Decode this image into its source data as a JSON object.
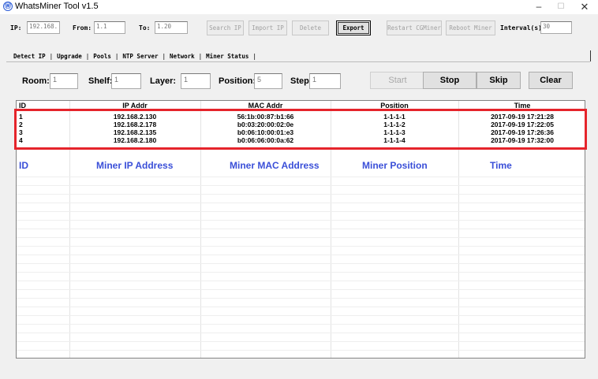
{
  "window": {
    "title": "WhatsMiner Tool v1.5",
    "app_icon": "Ⓦ",
    "minimize": "–",
    "maximize": "☐",
    "close": "✕"
  },
  "toolbar": {
    "ip_label": "IP:",
    "ip_value": "192.168.",
    "from_label": "From:",
    "from_value": "1.1",
    "to_label": "To:",
    "to_value": "1.20",
    "search_ip": "Search IP",
    "import_ip": "Import IP",
    "delete": "Delete",
    "export": "Export",
    "restart_cgminer": "Restart CGMiner",
    "reboot_miner": "Reboot Miner",
    "interval_label": "Interval(s)",
    "interval_value": "30"
  },
  "tabs": [
    "Detect IP",
    "Upgrade",
    "Pools",
    "NTP Server",
    "Network",
    "Miner Status"
  ],
  "detect": {
    "room_label": "Room:",
    "room_value": "1",
    "shelf_label": "Shelf:",
    "shelf_value": "1",
    "layer_label": "Layer:",
    "layer_value": "1",
    "position_label": "Position:",
    "position_value": "5",
    "step_label": "Step:",
    "step_value": "1",
    "start": "Start",
    "stop": "Stop",
    "skip": "Skip",
    "clear": "Clear"
  },
  "table": {
    "headers": [
      "ID",
      "IP Addr",
      "MAC Addr",
      "Position",
      "Time"
    ],
    "rows": [
      [
        "1",
        "192.168.2.130",
        "56:1b:00:87:b1:66",
        "1-1-1-1",
        "2017-09-19 17:21:28"
      ],
      [
        "2",
        "192.168.2.178",
        "b0:03:20:00:02:0e",
        "1-1-1-2",
        "2017-09-19 17:22:05"
      ],
      [
        "3",
        "192.168.2.135",
        "b0:06:10:00:01:e3",
        "1-1-1-3",
        "2017-09-19 17:26:36"
      ],
      [
        "4",
        "192.168.2.180",
        "b0:06:06:00:0a:62",
        "1-1-1-4",
        "2017-09-19 17:32:00"
      ]
    ],
    "annotation_headers": [
      "ID",
      "Miner IP Address",
      "Miner MAC Address",
      "Miner Position",
      "Time"
    ]
  },
  "colors": {
    "highlight": "#e5242b",
    "annotation_text": "#3a4fd8"
  }
}
